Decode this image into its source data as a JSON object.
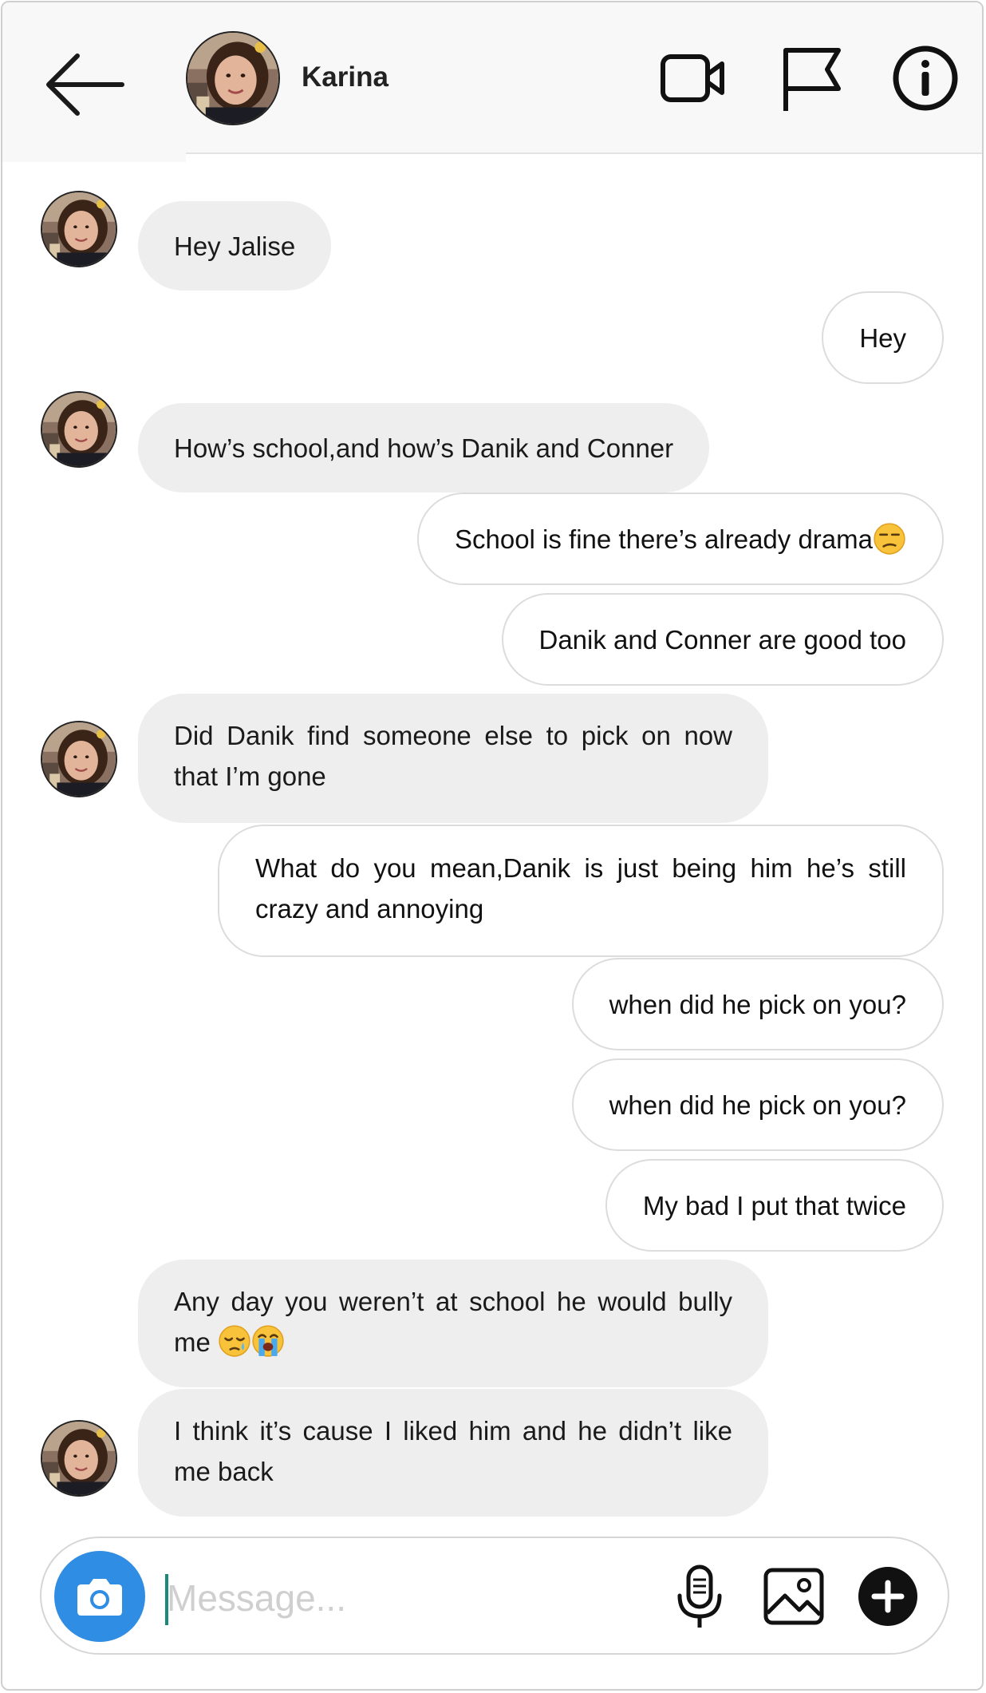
{
  "header": {
    "contact_name": "Karina",
    "icons": [
      "back-arrow-icon",
      "video-call-icon",
      "flag-icon",
      "info-icon"
    ]
  },
  "messages": [
    {
      "from": "contact",
      "text": "Hey Jalise"
    },
    {
      "from": "me",
      "text": "Hey"
    },
    {
      "from": "contact",
      "text": "How’s school,and how’s Danik and Conner"
    },
    {
      "from": "me",
      "text": "School is fine there’s already drama",
      "emoji": [
        "unamused-face-emoji"
      ]
    },
    {
      "from": "me",
      "text": "Danik and Conner are good too"
    },
    {
      "from": "contact",
      "text": "Did Danik find someone else to pick on now that I’m gone"
    },
    {
      "from": "me",
      "text": "What do you mean,Danik is just being him he’s still crazy and annoying"
    },
    {
      "from": "me",
      "text": "when did he pick on you?"
    },
    {
      "from": "me",
      "text": "when did he pick on you?"
    },
    {
      "from": "me",
      "text": "My bad I put that twice"
    },
    {
      "from": "contact",
      "text": "Any day you weren’t at school he would bully me ",
      "emoji": [
        "sleepy-face-emoji",
        "loudly-crying-face-emoji"
      ]
    },
    {
      "from": "contact",
      "text": "I think it’s cause I liked him and he didn’t like me back"
    }
  ],
  "composer": {
    "placeholder": "Message...",
    "value": "",
    "icons": [
      "camera-icon",
      "microphone-icon",
      "gallery-icon",
      "add-icon"
    ]
  },
  "colors": {
    "incoming_bubble": "#eeeeee",
    "outgoing_border": "#dcdcdc",
    "camera_button": "#2f8de4",
    "header_bg": "#f8f8f8"
  }
}
